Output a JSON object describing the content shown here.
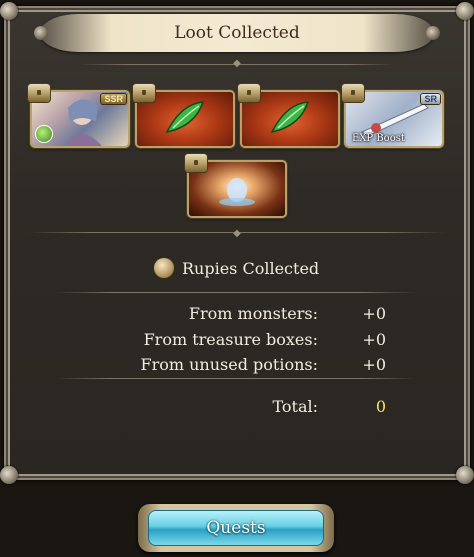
{
  "header": {
    "title": "Loot Collected"
  },
  "loot": {
    "items": [
      {
        "kind": "character",
        "rarity": "SSR"
      },
      {
        "kind": "element-crystal",
        "rarity": ""
      },
      {
        "kind": "element-crystal",
        "rarity": ""
      },
      {
        "kind": "weapon",
        "rarity": "SR",
        "tag": "EXP Boost"
      },
      {
        "kind": "orb",
        "rarity": ""
      }
    ]
  },
  "rupies": {
    "title": "Rupies Collected",
    "rows": [
      {
        "label": "From monsters:",
        "value": "+0"
      },
      {
        "label": "From treasure boxes:",
        "value": "+0"
      },
      {
        "label": "From unused potions:",
        "value": "+0"
      }
    ],
    "total_label": "Total:",
    "total_value": "0"
  },
  "footer": {
    "quests_label": "Quests"
  },
  "colors": {
    "total_accent": "#f3e46a",
    "button_accent": "#65cfe3"
  }
}
